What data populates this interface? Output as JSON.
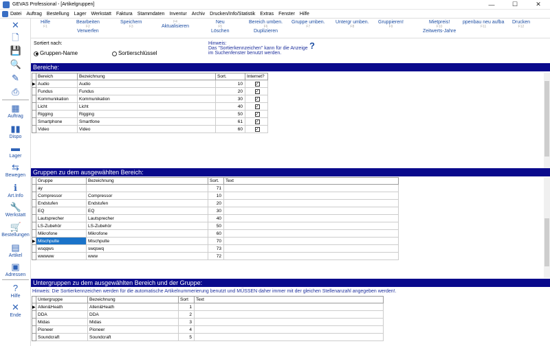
{
  "window": {
    "title": "GEVAS Professional - [Artikelgruppen]"
  },
  "menu": [
    "Datei",
    "Auftrag",
    "Bestellung",
    "Lager",
    "Werkstatt",
    "Faktura",
    "Stammdaten",
    "Inventur",
    "Archiv",
    "Drucken/Info/Statistik",
    "Extras",
    "Fenster",
    "Hilfe"
  ],
  "sidebar": [
    {
      "label": "",
      "icon": "close-icon"
    },
    {
      "label": "",
      "icon": "new-document-icon"
    },
    {
      "label": "",
      "icon": "save-icon"
    },
    {
      "label": "",
      "icon": "search-icon"
    },
    {
      "label": "",
      "icon": "pen-icon"
    },
    {
      "label": "",
      "icon": "printer-icon"
    },
    {
      "label": "Auftrag",
      "icon": "order-icon"
    },
    {
      "label": "Dispo",
      "icon": "chart-icon"
    },
    {
      "label": "Lager",
      "icon": "truck-icon"
    },
    {
      "label": "Bewegen",
      "icon": "move-icon"
    },
    {
      "label": "Art.Info",
      "icon": "info-icon"
    },
    {
      "label": "Werkstatt",
      "icon": "wrench-icon"
    },
    {
      "label": "Bestellungen",
      "icon": "cart-icon"
    },
    {
      "label": "Artikel",
      "icon": "article-icon"
    },
    {
      "label": "Adressen",
      "icon": "address-icon"
    },
    {
      "label": "Hilfe",
      "icon": "help-icon"
    },
    {
      "label": "Ende",
      "icon": "exit-icon"
    }
  ],
  "toolbar": [
    {
      "top": "Hilfe",
      "fkey": "F1"
    },
    {
      "top": "Bearbeiten",
      "fkey": "F2",
      "bottom": "Verwerfen"
    },
    {
      "top": "Speichern",
      "fkey": "F3"
    },
    {
      "top": "",
      "fkey": "F4",
      "bottom": "Aktualisieren"
    },
    {
      "top": "Neu",
      "fkey": "F5",
      "bottom": "Löschen"
    },
    {
      "top": "Bereich umben.",
      "fkey": "F6",
      "bottom": "Duplizieren"
    },
    {
      "top": "Gruppe umben.",
      "fkey": "F7"
    },
    {
      "top": "Untergr umben.",
      "fkey": "F8"
    },
    {
      "top": "Gruppieren!",
      "fkey": "F9"
    },
    {
      "top": "Mietpreis!",
      "fkey": "F10",
      "bottom": "Zeitwerts-Jahre"
    },
    {
      "top": "ppenbau neu aufba",
      "fkey": "F11"
    },
    {
      "top": "Drucken",
      "fkey": "F12"
    }
  ],
  "sort": {
    "label": "Sortiert nach:",
    "option1": "Gruppen-Name",
    "option2": "Sortierschlüssel",
    "selected": "Gruppen-Name",
    "hint_title": "Hinweis:",
    "hint_line1": "Das \"Sortierkennzeichen\" kann für die Anzeige",
    "hint_line2": "im Suchenfenster benutzt werden."
  },
  "bereiche": {
    "title": "Bereiche:",
    "columns": [
      "Bereich",
      "Bezeichnung",
      "Sort.",
      "Internet?"
    ],
    "rows": [
      {
        "bereich": "Audio",
        "bez": "Audio",
        "sort": "10",
        "internet": true,
        "current": true
      },
      {
        "bereich": "Fundus",
        "bez": "Fundus",
        "sort": "20",
        "internet": true
      },
      {
        "bereich": "Kommunikation",
        "bez": "Kommunikation",
        "sort": "30",
        "internet": true
      },
      {
        "bereich": "Licht",
        "bez": "Licht",
        "sort": "40",
        "internet": true
      },
      {
        "bereich": "Rigging",
        "bez": "Rigging",
        "sort": "50",
        "internet": true
      },
      {
        "bereich": "Smartphone",
        "bez": "Smartfone",
        "sort": "61",
        "internet": true
      },
      {
        "bereich": "Video",
        "bez": "Video",
        "sort": "60",
        "internet": true
      }
    ]
  },
  "gruppen": {
    "title": "Gruppen zu dem ausgewählten Bereich:",
    "columns": [
      "Gruppe",
      "Bezeichnung",
      "Sort.",
      "Text"
    ],
    "rows": [
      {
        "gruppe": "ay",
        "bez": "",
        "sort": "71"
      },
      {
        "gruppe": "Compressor",
        "bez": "Compressor",
        "sort": "10"
      },
      {
        "gruppe": "Endstufen",
        "bez": "Endstufen",
        "sort": "20"
      },
      {
        "gruppe": "EQ",
        "bez": "EQ",
        "sort": "30"
      },
      {
        "gruppe": "Lautsprecher",
        "bez": "Lautsprecher",
        "sort": "40"
      },
      {
        "gruppe": "LS-Zubehör",
        "bez": "LS-Zubehör",
        "sort": "50"
      },
      {
        "gruppe": "Mikrofone",
        "bez": "Mikrofone",
        "sort": "60"
      },
      {
        "gruppe": "Mischpulte",
        "bez": "Mischpulte",
        "sort": "70",
        "current": true
      },
      {
        "gruppe": "wsqqws",
        "bez": "swqswq",
        "sort": "73"
      },
      {
        "gruppe": "wwwww",
        "bez": "www",
        "sort": "72"
      }
    ]
  },
  "untergruppen": {
    "title": "Untergruppen zu dem ausgewählten Bereich und der Gruppe:",
    "hint": "Hinweis: Die Sortierkennzeichen werden für die automatische Artikelnummerierung benutzt und MÜSSEN daher immer mit der gleichen Stellenanzahl angegeben werden!.",
    "columns": [
      "Untergruppe",
      "Bezeichnung",
      "Sort",
      "Text"
    ],
    "rows": [
      {
        "ug": "Allen&Heath",
        "bez": "Allen&Heath",
        "sort": "1",
        "current": true
      },
      {
        "ug": "DDA",
        "bez": "DDA",
        "sort": "2"
      },
      {
        "ug": "Midas",
        "bez": "Midas",
        "sort": "3"
      },
      {
        "ug": "Pioneer",
        "bez": "Pioneer",
        "sort": "4"
      },
      {
        "ug": "Soundcraft",
        "bez": "Soundcraft",
        "sort": "5"
      }
    ]
  }
}
